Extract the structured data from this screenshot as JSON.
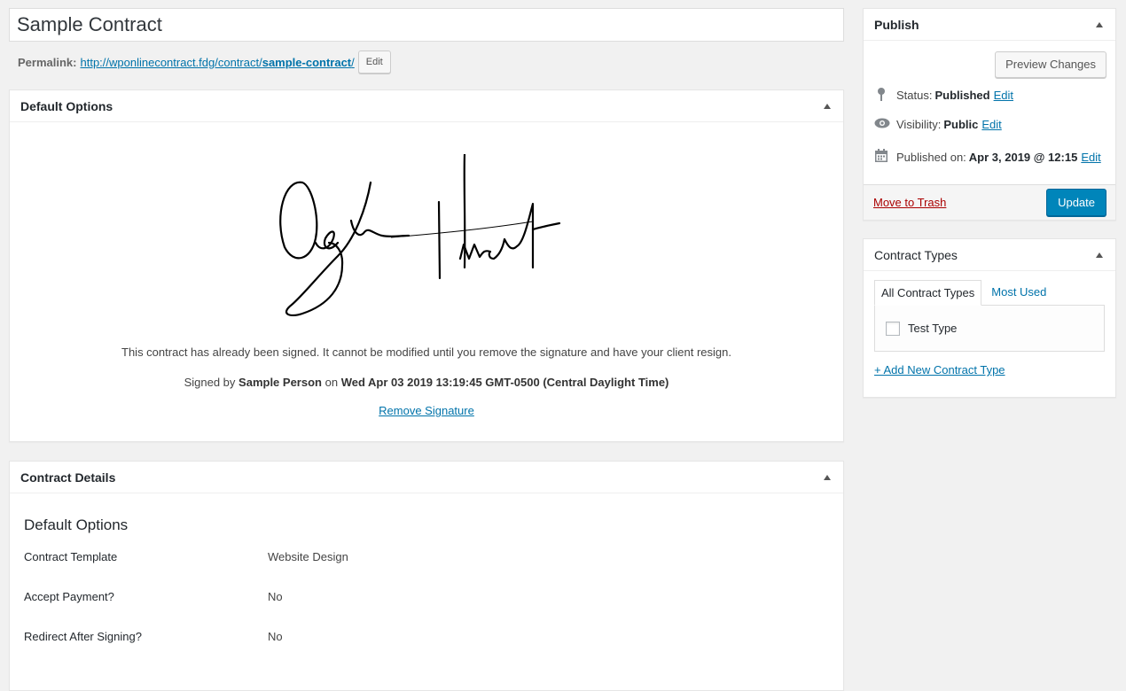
{
  "post": {
    "title": "Sample Contract",
    "permalink_label": "Permalink:",
    "permalink_base": "http://wponlinecontract.fdg/contract/",
    "permalink_slug": "sample-contract",
    "permalink_trailing": "/",
    "edit_slug_label": "Edit"
  },
  "default_options_box": {
    "title": "Default Options",
    "signed_notice": "This contract has already been signed. It cannot be modified until you remove the signature and have your client resign.",
    "signed_by_prefix": "Signed by",
    "signer": "Sample Person",
    "signed_on_word": "on",
    "signed_date": "Wed Apr 03 2019 13:19:45 GMT-0500 (Central Daylight Time)",
    "remove_signature_label": "Remove Signature"
  },
  "contract_details_box": {
    "title": "Contract Details",
    "section_heading": "Default Options",
    "rows": [
      {
        "label": "Contract Template",
        "value": "Website Design"
      },
      {
        "label": "Accept Payment?",
        "value": "No"
      },
      {
        "label": "Redirect After Signing?",
        "value": "No"
      }
    ]
  },
  "publish_box": {
    "title": "Publish",
    "preview_label": "Preview Changes",
    "status_label": "Status:",
    "status_value": "Published",
    "visibility_label": "Visibility:",
    "visibility_value": "Public",
    "published_label": "Published on:",
    "published_value": "Apr 3, 2019 @ 12:15",
    "edit_label": "Edit",
    "trash_label": "Move to Trash",
    "update_label": "Update"
  },
  "contract_types_box": {
    "title": "Contract Types",
    "tab_all": "All Contract Types",
    "tab_most_used": "Most Used",
    "types": [
      {
        "label": "Test Type",
        "checked": false
      }
    ],
    "add_new_label": "+ Add New Contract Type"
  },
  "colors": {
    "link": "#0073aa",
    "primary_button": "#0085ba",
    "trash": "#a00",
    "background": "#f1f1f1"
  }
}
